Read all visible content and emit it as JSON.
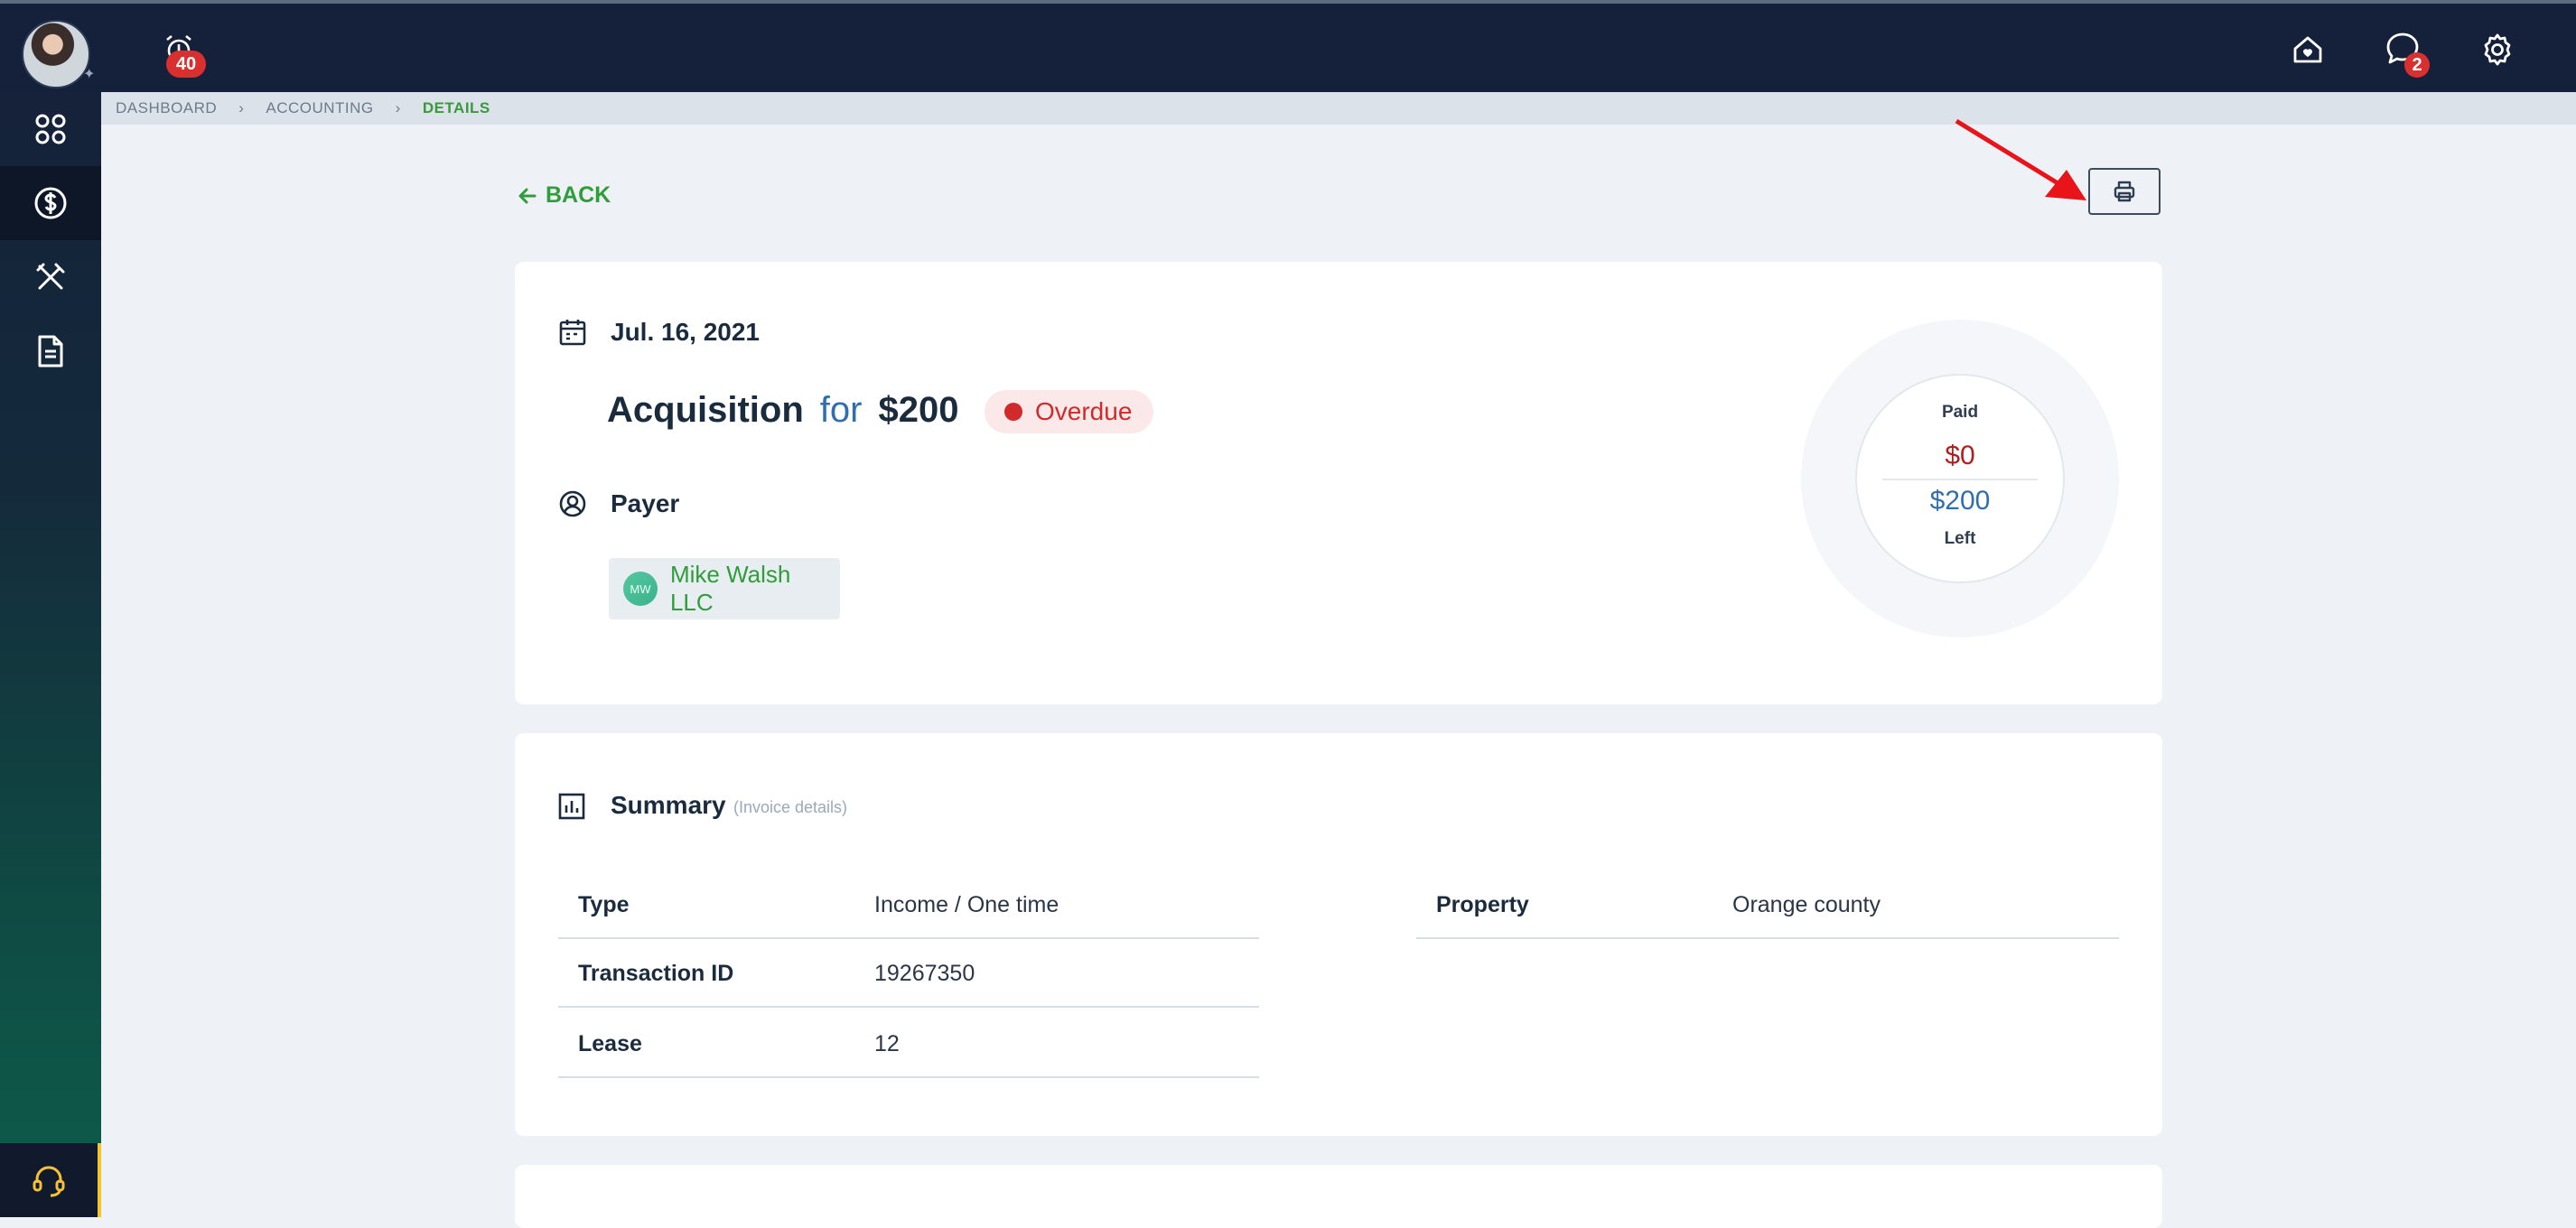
{
  "topbar": {
    "alerts_count": "40",
    "messages_count": "2",
    "icons": [
      "alarm-clock-icon",
      "home-icon",
      "chat-icon",
      "gear-icon"
    ]
  },
  "sidebar": {
    "items": [
      {
        "icon": "grid-icon"
      },
      {
        "icon": "dollar-icon",
        "active": true
      },
      {
        "icon": "tools-icon"
      },
      {
        "icon": "document-icon"
      }
    ],
    "support_icon": "headset-icon"
  },
  "breadcrumb": {
    "items": [
      "DASHBOARD",
      "ACCOUNTING",
      "DETAILS"
    ]
  },
  "back_label": "BACK",
  "invoice": {
    "date": "Jul. 16, 2021",
    "title": "Acquisition",
    "for_word": "for",
    "amount": "$200",
    "status": "Overdue",
    "payer_label": "Payer",
    "payer_initials": "MW",
    "payer_name": "Mike Walsh LLC"
  },
  "payment": {
    "paid_label": "Paid",
    "paid": "$0",
    "left": "$200",
    "left_label": "Left"
  },
  "summary": {
    "title": "Summary",
    "subtitle": "(Invoice details)",
    "left_rows": [
      {
        "key": "Type",
        "value": "Income / One time"
      },
      {
        "key": "Transaction ID",
        "value": "19267350"
      },
      {
        "key": "Lease",
        "value": "12"
      }
    ],
    "right_rows": [
      {
        "key": "Property",
        "value": "Orange county"
      }
    ]
  },
  "colors": {
    "topbar": "#15213a",
    "accent_green": "#2f9d3a",
    "overdue_red": "#d12a2a",
    "link_blue": "#2f6fb0",
    "annotation_arrow": "#e8141a"
  }
}
